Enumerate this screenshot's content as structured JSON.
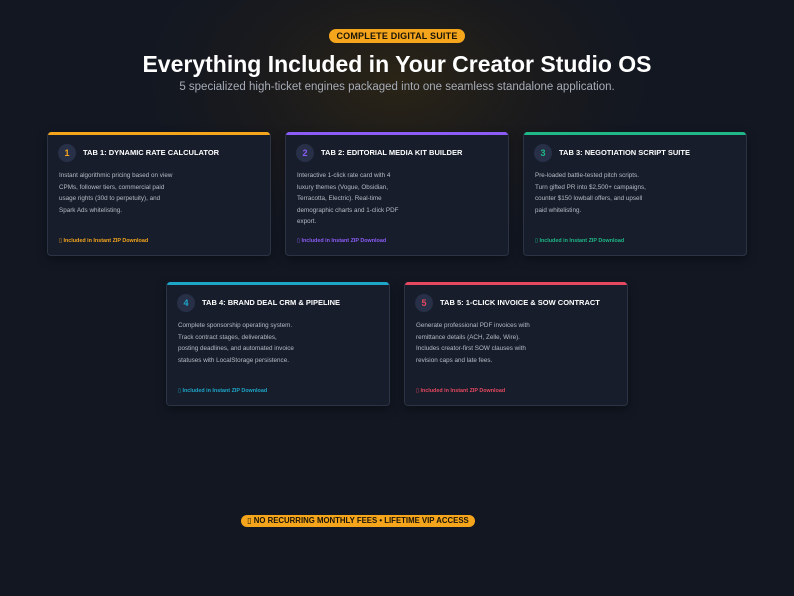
{
  "hero": {
    "badge": "COMPLETE DIGITAL SUITE",
    "title": "Everything Included in Your Creator Studio OS",
    "subtitle": "5 specialized high-ticket engines packaged into one seamless standalone application."
  },
  "cards": [
    {
      "number": "1",
      "title": "TAB 1: DYNAMIC RATE CALCULATOR",
      "description_lines": [
        "Instant algorithmic pricing based on view",
        "CPMs, follower tiers, commercial paid",
        "usage rights (30d to perpetuity), and",
        "Spark Ads whitelisting."
      ],
      "footer": "▯ Included in Instant ZIP Download",
      "accent": "#f4a51c"
    },
    {
      "number": "2",
      "title": "TAB 2: EDITORIAL MEDIA KIT BUILDER",
      "description_lines": [
        "Interactive 1-click rate card with 4",
        "luxury themes (Vogue, Obsidian,",
        "Terracotta, Electric). Real-time",
        "demographic charts and 1-click PDF",
        "export."
      ],
      "footer": "▯ Included in Instant ZIP Download",
      "accent": "#8b5cf6"
    },
    {
      "number": "3",
      "title": "TAB 3: NEGOTIATION SCRIPT SUITE",
      "description_lines": [
        "Pre-loaded battle-tested pitch scripts.",
        "Turn gifted PR into $2,500+ campaigns,",
        "counter $150 lowball offers, and upsell",
        "paid whitelisting."
      ],
      "footer": "▯ Included in Instant ZIP Download",
      "accent": "#1fb886"
    },
    {
      "number": "4",
      "title": "TAB 4: BRAND DEAL CRM & PIPELINE",
      "description_lines": [
        "Complete sponsorship operating system.",
        "Track contract stages, deliverables,",
        "posting deadlines, and automated invoice",
        "statuses with LocalStorage persistence."
      ],
      "footer": "▯ Included in Instant ZIP Download",
      "accent": "#1ea6c8"
    },
    {
      "number": "5",
      "title": "TAB 5: 1-CLICK INVOICE & SOW CONTRACT",
      "description_lines": [
        "Generate professional PDF invoices with",
        "remittance details (ACH, Zelle, Wire).",
        "Includes creator-first SOW clauses with",
        "revision caps and late fees."
      ],
      "footer": "▯ Included in Instant ZIP Download",
      "accent": "#e5485f"
    }
  ],
  "bottom_badge": "▯ NO RECURRING MONTHLY FEES • LIFETIME VIP ACCESS"
}
